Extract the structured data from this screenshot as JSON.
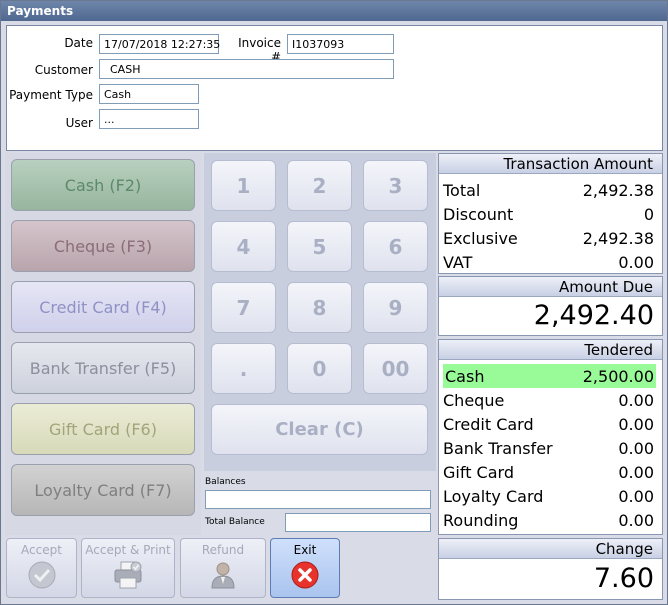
{
  "window": {
    "title": "Payments"
  },
  "form": {
    "date_label": "Date",
    "date_value": "17/07/2018 12:27:35",
    "invoice_label": "Invoice #",
    "invoice_value": "I1037093",
    "customer_label": "Customer",
    "customer_value": "CASH",
    "payment_type_label": "Payment Type",
    "payment_type_value": "Cash",
    "user_label": "User",
    "user_value": "..."
  },
  "methods": [
    {
      "label": "Cash (F2)"
    },
    {
      "label": "Cheque (F3)"
    },
    {
      "label": "Credit Card (F4)"
    },
    {
      "label": "Bank Transfer (F5)"
    },
    {
      "label": "Gift Card (F6)"
    },
    {
      "label": "Loyalty Card (F7)"
    }
  ],
  "keypad": {
    "keys": [
      "1",
      "2",
      "3",
      "4",
      "5",
      "6",
      "7",
      "8",
      "9",
      ".",
      "0",
      "00"
    ],
    "clear_label": "Clear (C)"
  },
  "balances": {
    "balances_label": "Balances",
    "balances_value": "",
    "total_balance_label": "Total Balance",
    "total_balance_value": ""
  },
  "actions": {
    "accept_label": "Accept",
    "accept_print_label": "Accept & Print",
    "refund_label": "Refund",
    "exit_label": "Exit"
  },
  "transaction": {
    "header": "Transaction Amount",
    "rows": [
      {
        "label": "Total",
        "value": "2,492.38"
      },
      {
        "label": "Discount",
        "value": "0"
      },
      {
        "label": "Exclusive",
        "value": "2,492.38"
      },
      {
        "label": "VAT",
        "value": "0.00"
      }
    ]
  },
  "amount_due": {
    "header": "Amount Due",
    "value": "2,492.40"
  },
  "tendered": {
    "header": "Tendered",
    "rows": [
      {
        "label": "Cash",
        "value": "2,500.00"
      },
      {
        "label": "Cheque",
        "value": "0.00"
      },
      {
        "label": "Credit Card",
        "value": "0.00"
      },
      {
        "label": "Bank Transfer",
        "value": "0.00"
      },
      {
        "label": "Gift Card",
        "value": "0.00"
      },
      {
        "label": "Loyalty Card",
        "value": "0.00"
      },
      {
        "label": "Rounding",
        "value": "0.00"
      }
    ]
  },
  "change": {
    "header": "Change",
    "value": "7.60"
  },
  "colors": {
    "highlight": "#98fb98",
    "title_bar": "#5a7299"
  },
  "icons": {
    "accept": "check-circle-icon",
    "accept_print": "printer-icon",
    "refund": "person-icon",
    "exit": "close-circle-icon"
  }
}
